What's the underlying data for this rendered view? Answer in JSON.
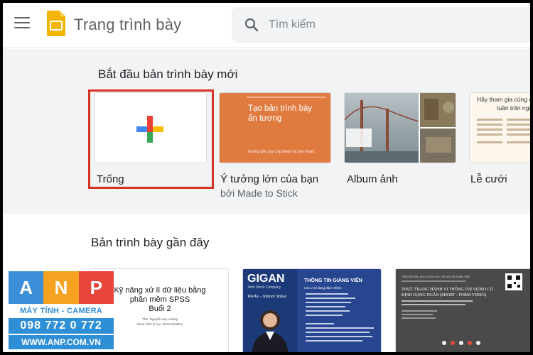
{
  "header": {
    "app_title": "Trang trình bày",
    "search_placeholder": "Tìm kiếm"
  },
  "templates": {
    "section_title": "Bắt đầu bản trình bày mới",
    "items": [
      {
        "label": "Trống",
        "subtitle": ""
      },
      {
        "label": "Ý tưởng lớn của bạn",
        "subtitle": "bởi Made to Stick",
        "thumb_title": "Tạo bản trình bày ấn tượng",
        "thumb_caption": "Hướng dẫn của Chip Heath và Dan Heath"
      },
      {
        "label": "Album ảnh",
        "subtitle": ""
      },
      {
        "label": "Lễ cưới",
        "subtitle": "",
        "thumb_title": "Hãy tham gia cùng chúng tôi tuần trăng mật"
      }
    ]
  },
  "recent": {
    "section_title": "Bản trình bày gần đây",
    "docs": [
      {
        "title": "Kỹ năng xử lí dữ liệu bằng phần mềm SPSS Buổi 2",
        "author": "ThS. Nguyễn Huy Hoàng",
        "author_sub": "Khoa Tâm lý học, ĐHKHXH&NV"
      },
      {
        "logo": "GIGAN",
        "logo_sub": "Joint Stock Company",
        "slogan": "Works - Nature Value",
        "heading": "THÔNG TIN GIẢNG VIÊN",
        "subheading": "Các vị trí đang đảm nhiệm"
      },
      {
        "university": "TRƯỜNG ĐẠI HỌC KHOA HỌC XÃ HỘI VÀ NHÂN VĂN",
        "title": "THỰC TRẠNG HÀNH VI THÔNG TIN VIDEO CÓ ĐỊNH DẠNG NGẮN (SHORT - FORM VIDEO)"
      }
    ]
  },
  "watermark": {
    "letters": [
      "A",
      "N",
      "P"
    ],
    "colors": [
      "#3b8fd9",
      "#f4a21f",
      "#e8453c"
    ],
    "tagline": "MÁY TÍNH - CAMERA",
    "phone": "098 772 0 772",
    "url": "WWW.ANP.COM.VN"
  }
}
